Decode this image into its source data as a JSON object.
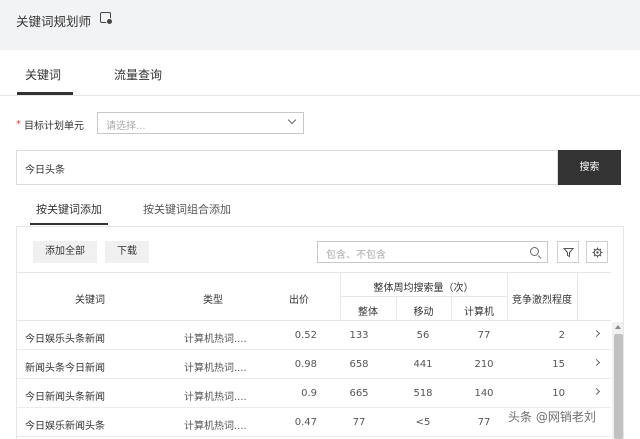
{
  "header": {
    "title": "关键词规划师",
    "title_icon": "info-card-icon"
  },
  "tabs": [
    {
      "label": "关键词",
      "active": true
    },
    {
      "label": "流量查询",
      "active": false
    }
  ],
  "form": {
    "unit_label": "目标计划单元",
    "required_mark": "*",
    "unit_placeholder": "请选择...",
    "search_value": "今日头条",
    "search_button": "搜索"
  },
  "subtabs": [
    {
      "label": "按关键词添加",
      "active": true
    },
    {
      "label": "按关键词组合添加",
      "active": false
    }
  ],
  "toolbar": {
    "add_all": "添加全部",
    "download": "下载",
    "filter_placeholder": "包含、不包含"
  },
  "table": {
    "headers": {
      "keyword": "关键词",
      "type": "类型",
      "bid": "出价",
      "weekly_group": "整体周均搜索量（次）",
      "all": "整体",
      "mobile": "移动",
      "pc": "计算机",
      "competition": "竞争激烈程度"
    },
    "rows": [
      {
        "keyword": "今日娱乐头条新闻",
        "type": "计算机热词....",
        "bid": "0.52",
        "all": "133",
        "mobile": "56",
        "pc": "77",
        "competition": "2"
      },
      {
        "keyword": "新闻头条今日新闻",
        "type": "计算机热词....",
        "bid": "0.98",
        "all": "658",
        "mobile": "441",
        "pc": "210",
        "competition": "15"
      },
      {
        "keyword": "今日新闻头条新闻",
        "type": "计算机热词....",
        "bid": "0.9",
        "all": "665",
        "mobile": "518",
        "pc": "140",
        "competition": "10"
      },
      {
        "keyword": "今日娱乐新闻头条",
        "type": "计算机热词....",
        "bid": "0.47",
        "all": "77",
        "mobile": "<5",
        "pc": "77",
        "competition": ""
      }
    ]
  },
  "watermark": "头条 @网销老刘"
}
